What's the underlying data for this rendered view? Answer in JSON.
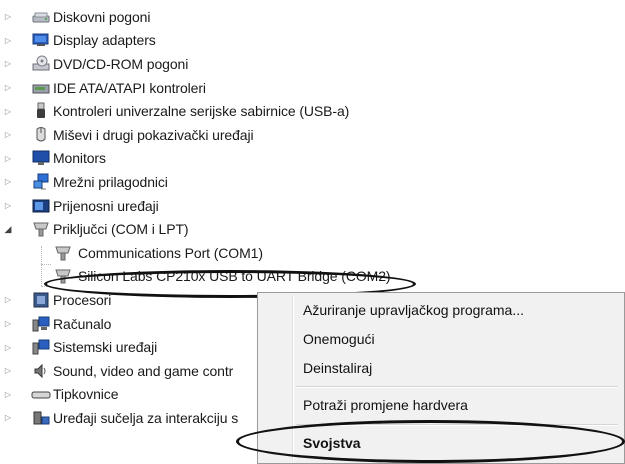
{
  "tree": {
    "categories": [
      {
        "label": "Diskovni pogoni",
        "icon": "disk-drive-icon",
        "expanded": false
      },
      {
        "label": "Display adapters",
        "icon": "display-adapter-icon",
        "expanded": false
      },
      {
        "label": "DVD/CD-ROM pogoni",
        "icon": "dvd-drive-icon",
        "expanded": false
      },
      {
        "label": "IDE ATA/ATAPI kontroleri",
        "icon": "ide-controller-icon",
        "expanded": false
      },
      {
        "label": "Kontroleri univerzalne serijske sabirnice (USB-a)",
        "icon": "usb-controller-icon",
        "expanded": false
      },
      {
        "label": "Miševi i drugi pokazivački uređaji",
        "icon": "mouse-icon",
        "expanded": false
      },
      {
        "label": "Monitors",
        "icon": "monitor-icon",
        "expanded": false
      },
      {
        "label": "Mrežni prilagodnici",
        "icon": "network-adapter-icon",
        "expanded": false
      },
      {
        "label": "Prijenosni uređaji",
        "icon": "portable-device-icon",
        "expanded": false
      },
      {
        "label": "Priključci (COM i LPT)",
        "icon": "port-icon",
        "expanded": true
      }
    ],
    "ports_children": [
      {
        "label": "Communications Port (COM1)",
        "icon": "port-icon"
      },
      {
        "label": "Silicon Labs CP210x USB to UART Bridge (COM2)",
        "icon": "port-icon"
      }
    ],
    "categories_after": [
      {
        "label": "Procesori",
        "icon": "processor-icon",
        "expanded": false
      },
      {
        "label": "Računalo",
        "icon": "computer-icon",
        "expanded": false
      },
      {
        "label": "Sistemski uređaji",
        "icon": "system-device-icon",
        "expanded": false
      },
      {
        "label": "Sound, video and game contr",
        "icon": "sound-icon",
        "expanded": false
      },
      {
        "label": "Tipkovnice",
        "icon": "keyboard-icon",
        "expanded": false
      },
      {
        "label": "Uređaji sučelja za interakciju s",
        "icon": "hid-icon",
        "expanded": false
      }
    ]
  },
  "context_menu": {
    "update_driver": "Ažuriranje upravljačkog programa...",
    "disable": "Onemogući",
    "uninstall": "Deinstaliraj",
    "scan_hardware": "Potraži promjene hardvera",
    "properties": "Svojstva"
  },
  "colors": {
    "highlight_ring": "#111111",
    "menu_background": "#f1f1f1",
    "expander": "#8a8a8a"
  }
}
